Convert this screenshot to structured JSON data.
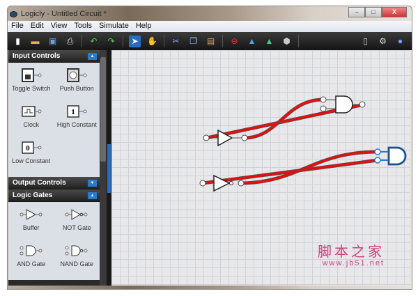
{
  "window": {
    "title": "Logicly - Untitled Circuit *",
    "minimize": "–",
    "maximize": "□",
    "close": "X"
  },
  "menu": [
    "File",
    "Edit",
    "View",
    "Tools",
    "Simulate",
    "Help"
  ],
  "sidebar": {
    "input_controls": {
      "title": "Input Controls",
      "items": [
        "Toggle Switch",
        "Push Button",
        "Clock",
        "High Constant",
        "Low Constant"
      ],
      "high_symbol": "1",
      "low_symbol": "0"
    },
    "output_controls": {
      "title": "Output Controls"
    },
    "logic_gates": {
      "title": "Logic Gates",
      "items": [
        "Buffer",
        "NOT Gate",
        "AND Gate",
        "NAND Gate"
      ]
    }
  },
  "watermark": {
    "text": "脚本之家",
    "url": "www.jb51.net"
  },
  "colors": {
    "wire": "#e01010",
    "selected": "#2a7ad0"
  }
}
